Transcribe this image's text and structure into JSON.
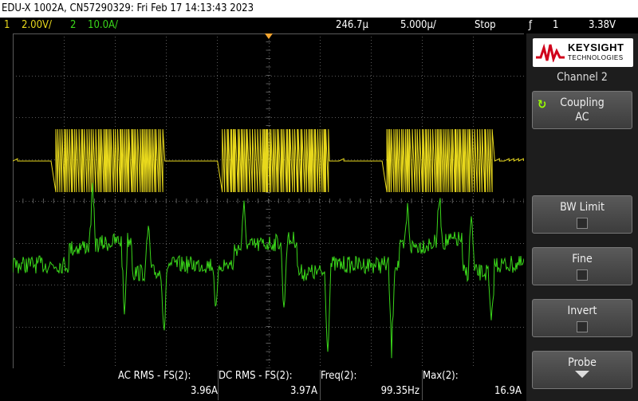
{
  "header": {
    "title": "EDU-X 1002A, CN57290329: Fri Feb 17 14:13:43 2023"
  },
  "status": {
    "ch1_num": "1",
    "ch1_scale": "2.00V/",
    "ch2_num": "2",
    "ch2_scale": "10.0A/",
    "time_position": "246.7µ",
    "time_scale": "5.000µ/",
    "run_state": "Stop",
    "trigger_icon": "ƒ",
    "trigger_source": "1",
    "trigger_level": "3.38V"
  },
  "colors": {
    "ch1": "#e8d81c",
    "ch2": "#3ad61a",
    "grid": "#5a5a5a",
    "trigger": "#f3a530"
  },
  "markers": {
    "ch1_ground": "1",
    "ch2_ground": "2",
    "trigger_level": "T"
  },
  "measurements": [
    {
      "label": "AC RMS - FS(2):",
      "value": "3.96A"
    },
    {
      "label": "DC RMS - FS(2):",
      "value": "3.97A"
    },
    {
      "label": "Freq(2):",
      "value": "99.35Hz"
    },
    {
      "label": "Max(2):",
      "value": "16.9A"
    }
  ],
  "side_panel": {
    "brand": "KEYSIGHT",
    "brand_sub": "TECHNOLOGIES",
    "title": "Channel 2",
    "softkeys": [
      {
        "label": "Coupling",
        "value": "AC"
      },
      {
        "label": "BW Limit"
      },
      {
        "label": "Fine"
      },
      {
        "label": "Invert"
      },
      {
        "label": "Probe"
      }
    ]
  }
}
